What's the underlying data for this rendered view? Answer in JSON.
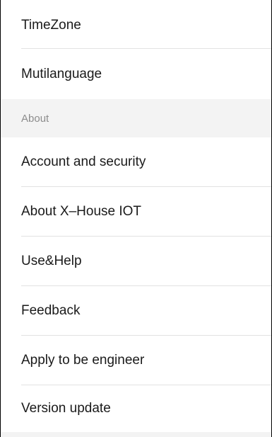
{
  "settings": {
    "items_top": [
      {
        "label": "TimeZone"
      },
      {
        "label": "Mutilanguage"
      }
    ],
    "section_header": "About",
    "items_about": [
      {
        "label": "Account and security"
      },
      {
        "label": "About X–House IOT"
      },
      {
        "label": "Use&Help"
      },
      {
        "label": "Feedback"
      },
      {
        "label": "Apply to be engineer"
      },
      {
        "label": "Version update"
      }
    ]
  },
  "colors": {
    "background": "#ffffff",
    "section_background": "#f3f3f3",
    "divider": "#e2e2e2",
    "section_text": "#8c8c8c",
    "item_text": "#1a1a1a"
  }
}
